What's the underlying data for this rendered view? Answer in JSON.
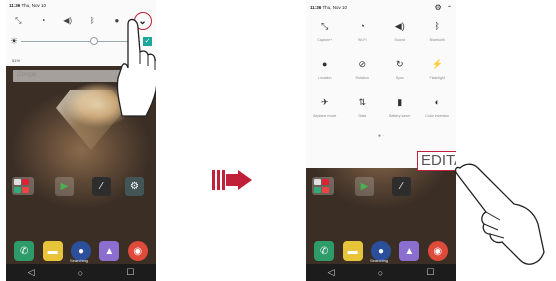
{
  "left_screen": {
    "status": {
      "time": "11:36",
      "date": "Thu, Nov 10"
    },
    "quick_icons": [
      "auto-rotate-icon",
      "wifi-icon",
      "sound-icon",
      "bluetooth-icon",
      "location-icon"
    ],
    "expand_icon": "chevron-down-icon",
    "brightness": {
      "percent_label": "51%",
      "level": 0.58,
      "auto_label": "Auto"
    },
    "search_placeholder": "Google",
    "searching_label": "Searching"
  },
  "right_screen": {
    "status": {
      "time": "11:36",
      "date": "Thu, Nov 10"
    },
    "tiles": [
      {
        "label": "Capture+",
        "icon": "capture-icon"
      },
      {
        "label": "Wi-Fi",
        "icon": "wifi-icon"
      },
      {
        "label": "Sound",
        "icon": "sound-icon"
      },
      {
        "label": "Bluetooth",
        "icon": "bluetooth-icon"
      },
      {
        "label": "Location",
        "icon": "location-icon"
      },
      {
        "label": "Rotation",
        "icon": "rotation-icon"
      },
      {
        "label": "Sync",
        "icon": "sync-icon"
      },
      {
        "label": "Flashlight",
        "icon": "flashlight-icon"
      },
      {
        "label": "Airplane mode",
        "icon": "airplane-icon"
      },
      {
        "label": "Data",
        "icon": "data-icon"
      },
      {
        "label": "Battery saver",
        "icon": "battery-saver-icon"
      },
      {
        "label": "Color inversion",
        "icon": "color-inversion-icon"
      }
    ],
    "edit_button_label": "EDITAR",
    "searching_label": "Searching"
  },
  "nav": {
    "back": "◁",
    "home": "○",
    "recents": "☐"
  },
  "colors": {
    "highlight": "#c0203a",
    "auto_toggle": "#1ba89a"
  }
}
